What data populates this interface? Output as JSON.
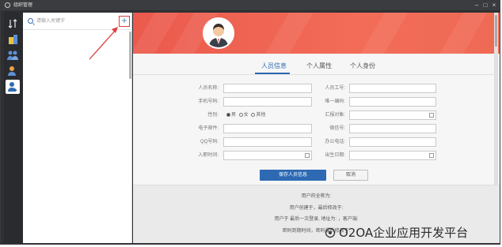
{
  "window": {
    "title": "组织管理",
    "controls": {
      "minimize": "–",
      "maximize": "□",
      "close": "×"
    }
  },
  "nav": {
    "items": [
      {
        "name": "sort-icon",
        "active": false
      },
      {
        "name": "organization-icon",
        "active": false
      },
      {
        "name": "group-icon",
        "active": false
      },
      {
        "name": "role-icon",
        "active": false
      },
      {
        "name": "person-icon",
        "active": true
      }
    ]
  },
  "search": {
    "placeholder": "请输入关键字",
    "add_label": "+"
  },
  "tabs": [
    {
      "label": "人员信息",
      "active": true
    },
    {
      "label": "个人属性",
      "active": false
    },
    {
      "label": "个人身份",
      "active": false
    }
  ],
  "form": {
    "name_label": "人员名称:",
    "employee_id_label": "人员工号:",
    "phone_label": "手机号码:",
    "unique_code_label": "唯一编码:",
    "gender_label": "性别:",
    "gender_options": [
      "男",
      "女",
      "其他"
    ],
    "gender_selected": "男",
    "report_to_label": "汇报对象:",
    "email_label": "电子邮件:",
    "wechat_label": "微信号:",
    "qq_label": "QQ号码:",
    "office_phone_label": "办公电话:",
    "join_date_label": "入职时间:",
    "birth_date_label": "出生日期:"
  },
  "actions": {
    "save_label": "保存人员信息",
    "cancel_label": "取消"
  },
  "footer": {
    "full_name_label": "用户的全称为:",
    "created_line": "用户创建于，最后修改于:",
    "login_line": "用户于 最后一次登录, 地址为: ，客户端:",
    "password_line": "密码到期时间，密码最后修改于:"
  },
  "watermark": {
    "text": "O2OA企业应用开发平台"
  },
  "colors": {
    "accent": "#2d6ab3",
    "banner": "#ef5f50",
    "annotation": "#e03c3c",
    "nav_bg": "#2a2b2e"
  }
}
